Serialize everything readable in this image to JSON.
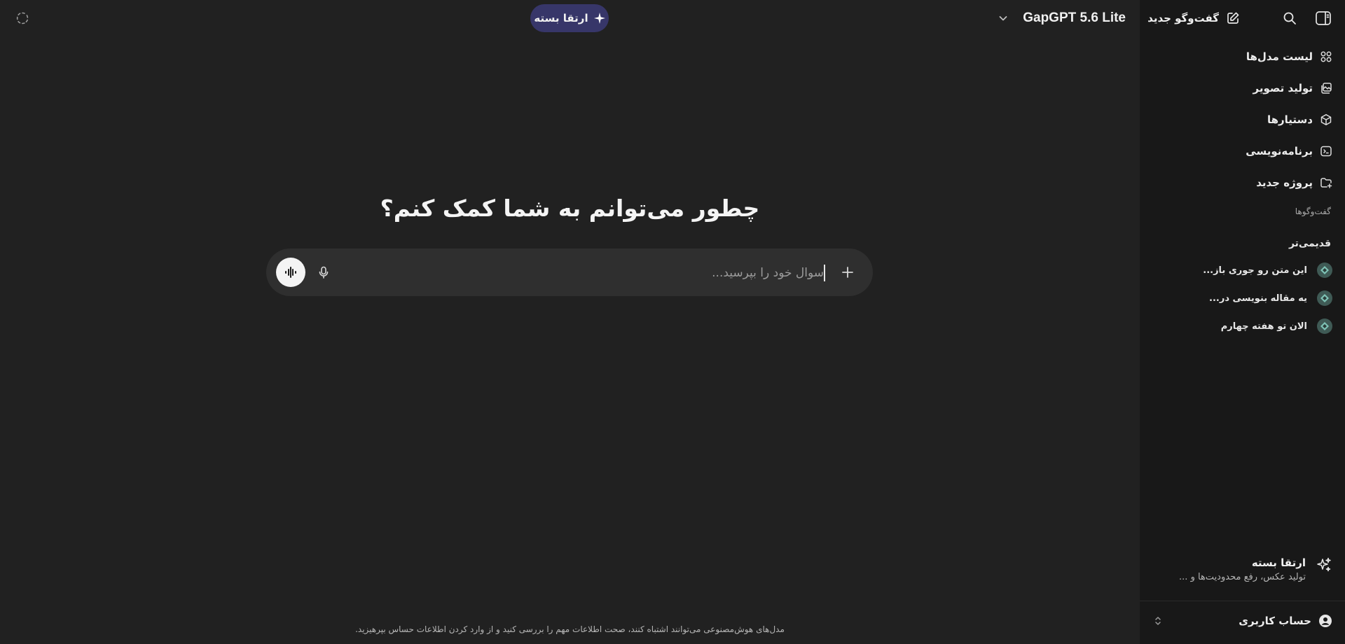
{
  "main": {
    "upgrade_pill": "ارتقا بسته",
    "model_name": "GapGPT 5.6 Lite",
    "hero_title": "چطور می‌توانم به شما کمک کنم؟",
    "composer_placeholder": "سوال خود را بپرسید...",
    "disclaimer": "مدل‌های هوش‌مصنوعی می‌توانند اشتباه کنند، صحت اطلاعات مهم را بررسی کنید و از وارد کردن اطلاعات حساس بپرهیزید."
  },
  "sidebar": {
    "new_chat": "گفت‌وگو جدید",
    "nav": [
      {
        "label": "لیست مدل‌ها",
        "icon": "grid-icon"
      },
      {
        "label": "تولید تصویر",
        "icon": "image-icon"
      },
      {
        "label": "دستیارها",
        "icon": "cube-icon"
      },
      {
        "label": "برنامه‌نویسی",
        "icon": "terminal-icon"
      },
      {
        "label": "پروژه جدید",
        "icon": "folder-plus-icon"
      }
    ],
    "section_label": "گفت‌وگوها",
    "older_label": "قدیمی‌تر",
    "history": [
      {
        "title": "این متن رو جوری باز..."
      },
      {
        "title": "یه مقاله بنویسی در..."
      },
      {
        "title": "الان تو هفته چهارم"
      }
    ],
    "upgrade_card": {
      "title": "ارتقا بسته",
      "subtitle": "تولید عکس، رفع محدودیت‌ها و ..."
    },
    "account_label": "حساب کاربری"
  },
  "colors": {
    "main_bg": "#212121",
    "sidebar_bg": "#181818",
    "pill_bg": "#373669",
    "composer_bg": "#2f2f2f",
    "gem_bg": "#3f5a55"
  }
}
